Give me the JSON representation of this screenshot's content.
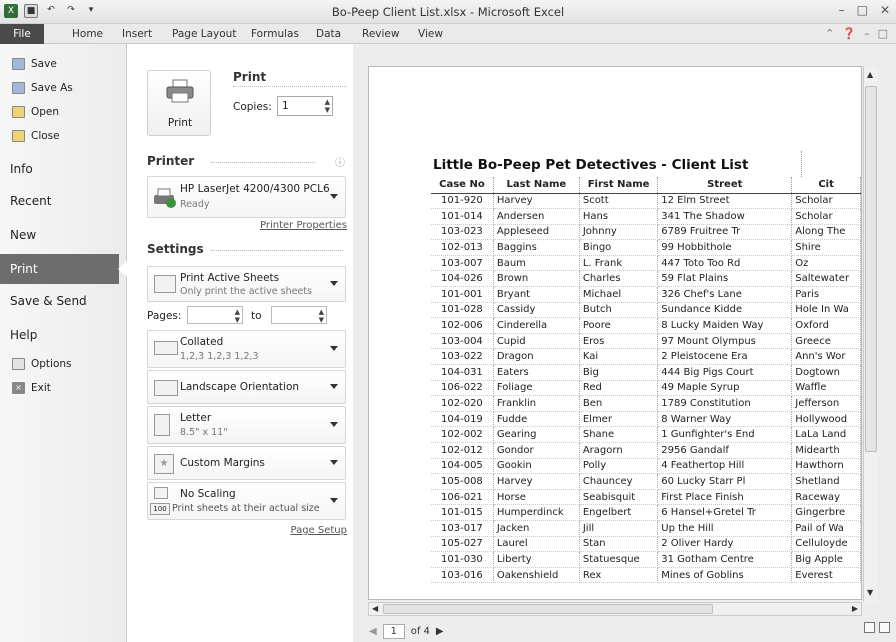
{
  "window": {
    "title": "Bo-Peep Client List.xlsx - Microsoft Excel",
    "controls": [
      "–",
      "□",
      "✕"
    ]
  },
  "ribbon_tabs": [
    "File",
    "Home",
    "Insert",
    "Page Layout",
    "Formulas",
    "Data",
    "Review",
    "View"
  ],
  "nav": {
    "small_items": [
      "Save",
      "Save As",
      "Open",
      "Close"
    ],
    "big_items": [
      "Info",
      "Recent",
      "New",
      "Print",
      "Save & Send",
      "Help"
    ],
    "bottom_items": [
      "Options",
      "Exit"
    ],
    "active": "Print"
  },
  "print_panel": {
    "print_button": "Print",
    "heading": "Print",
    "copies_label": "Copies:",
    "copies_value": "1",
    "printer_heading": "Printer",
    "printer_name": "HP LaserJet 4200/4300 PCL6",
    "printer_status": "Ready",
    "printer_properties": "Printer Properties",
    "settings_heading": "Settings",
    "active_sheets": {
      "main": "Print Active Sheets",
      "sub": "Only print the active sheets"
    },
    "pages_label": "Pages:",
    "pages_to": "to",
    "collated": {
      "main": "Collated",
      "sub": "1,2,3   1,2,3   1,2,3"
    },
    "orientation": "Landscape Orientation",
    "paper": {
      "main": "Letter",
      "sub": "8.5\" x 11\""
    },
    "margins": "Custom Margins",
    "scaling": {
      "main": "No Scaling",
      "sub": "Print sheets at their actual size",
      "badge": "100"
    },
    "page_setup": "Page Setup"
  },
  "preview": {
    "sheet_title": "Little Bo-Peep Pet Detectives - Client List",
    "columns": [
      "Case No",
      "Last Name",
      "First Name",
      "Street",
      "Cit"
    ],
    "rows": [
      [
        "101-920",
        "Harvey",
        "Scott",
        "12 Elm Street",
        "Scholar"
      ],
      [
        "101-014",
        "Andersen",
        "Hans",
        "341 The Shadow",
        "Scholar"
      ],
      [
        "103-023",
        "Appleseed",
        "Johnny",
        "6789 Fruitree Tr",
        "Along The"
      ],
      [
        "102-013",
        "Baggins",
        "Bingo",
        "99 Hobbithole",
        "Shire"
      ],
      [
        "103-007",
        "Baum",
        "L. Frank",
        "447 Toto Too Rd",
        "Oz"
      ],
      [
        "104-026",
        "Brown",
        "Charles",
        "59 Flat Plains",
        "Saltewater"
      ],
      [
        "101-001",
        "Bryant",
        "Michael",
        "326 Chef's Lane",
        "Paris"
      ],
      [
        "101-028",
        "Cassidy",
        "Butch",
        "Sundance Kidde",
        "Hole In Wa"
      ],
      [
        "102-006",
        "Cinderella",
        "Poore",
        "8 Lucky Maiden Way",
        "Oxford"
      ],
      [
        "103-004",
        "Cupid",
        "Eros",
        "97 Mount Olympus",
        "Greece"
      ],
      [
        "103-022",
        "Dragon",
        "Kai",
        "2 Pleistocene Era",
        "Ann's Wor"
      ],
      [
        "104-031",
        "Eaters",
        "Big",
        "444 Big Pigs Court",
        "Dogtown"
      ],
      [
        "106-022",
        "Foliage",
        "Red",
        "49 Maple Syrup",
        "Waffle"
      ],
      [
        "102-020",
        "Franklin",
        "Ben",
        "1789 Constitution",
        "Jefferson"
      ],
      [
        "104-019",
        "Fudde",
        "Elmer",
        "8 Warner Way",
        "Hollywood"
      ],
      [
        "102-002",
        "Gearing",
        "Shane",
        "1 Gunfighter's End",
        "LaLa Land"
      ],
      [
        "102-012",
        "Gondor",
        "Aragorn",
        "2956 Gandalf",
        "Midearth"
      ],
      [
        "104-005",
        "Gookin",
        "Polly",
        "4 Feathertop Hill",
        "Hawthorn"
      ],
      [
        "105-008",
        "Harvey",
        "Chauncey",
        "60 Lucky Starr Pl",
        "Shetland"
      ],
      [
        "106-021",
        "Horse",
        "Seabisquit",
        "First Place Finish",
        "Raceway"
      ],
      [
        "101-015",
        "Humperdinck",
        "Engelbert",
        "6 Hansel+Gretel Tr",
        "Gingerbre"
      ],
      [
        "103-017",
        "Jacken",
        "Jill",
        "Up the Hill",
        "Pail of Wa"
      ],
      [
        "105-027",
        "Laurel",
        "Stan",
        "2 Oliver Hardy",
        "Celluloyde"
      ],
      [
        "101-030",
        "Liberty",
        "Statuesque",
        "31 Gotham Centre",
        "Big Apple"
      ],
      [
        "103-016",
        "Oakenshield",
        "Rex",
        "Mines of Goblins",
        "Everest"
      ]
    ],
    "page_current": "1",
    "page_total": "of 4"
  }
}
